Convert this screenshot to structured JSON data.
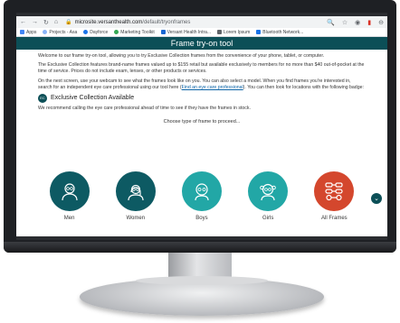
{
  "browser": {
    "url_domain": "microsite.versanthealth.com",
    "url_path": "/default/tryonframes",
    "bookmarks": [
      {
        "label": "Apps",
        "color": "#4285f4"
      },
      {
        "label": "Projects - Asa",
        "color": "#8ab4f8"
      },
      {
        "label": "Dayforce",
        "color": "#1a73e8"
      },
      {
        "label": "Marketing Toolkit",
        "color": "#34a853"
      },
      {
        "label": "Versant Health Intra...",
        "color": "#1967d2"
      },
      {
        "label": "Lorem Ipsum",
        "color": "#5f6368"
      },
      {
        "label": "Bluetooth Network...",
        "color": "#1a73e8"
      }
    ]
  },
  "page": {
    "title": "Frame try-on tool",
    "intro": "Welcome to our frame try-on tool, allowing you to try Exclusive Collection frames from the convenience of your phone, tablet, or computer.",
    "collection_text": "The Exclusive Collection features brand-name frames valued up to $155 retail but available exclusively to members for no more than $40 out-of-pocket at the time of service. Prices do not include exam, lenses, or other products or services.",
    "next_screen_text": "On the next screen, use your webcam to see what the frames look like on you. You can also select a model. When you find frames you're interested in, search for an independent eye care professional using our tool here (",
    "link_text": "Find an eye care professional",
    "next_screen_tail": "). You can then look for locations with the following badge:",
    "badge_label": "Exclusive Collection Available",
    "recommend_text": "We recommend calling the eye care professional ahead of time to see if they have the frames in stock.",
    "choose_text": "Choose type of frame to proceed...",
    "frames": [
      {
        "label": "Men",
        "icon": "man-icon"
      },
      {
        "label": "Women",
        "icon": "woman-icon"
      },
      {
        "label": "Boys",
        "icon": "boy-icon"
      },
      {
        "label": "Girls",
        "icon": "girl-icon"
      },
      {
        "label": "All Frames",
        "icon": "glasses-icon"
      }
    ]
  }
}
